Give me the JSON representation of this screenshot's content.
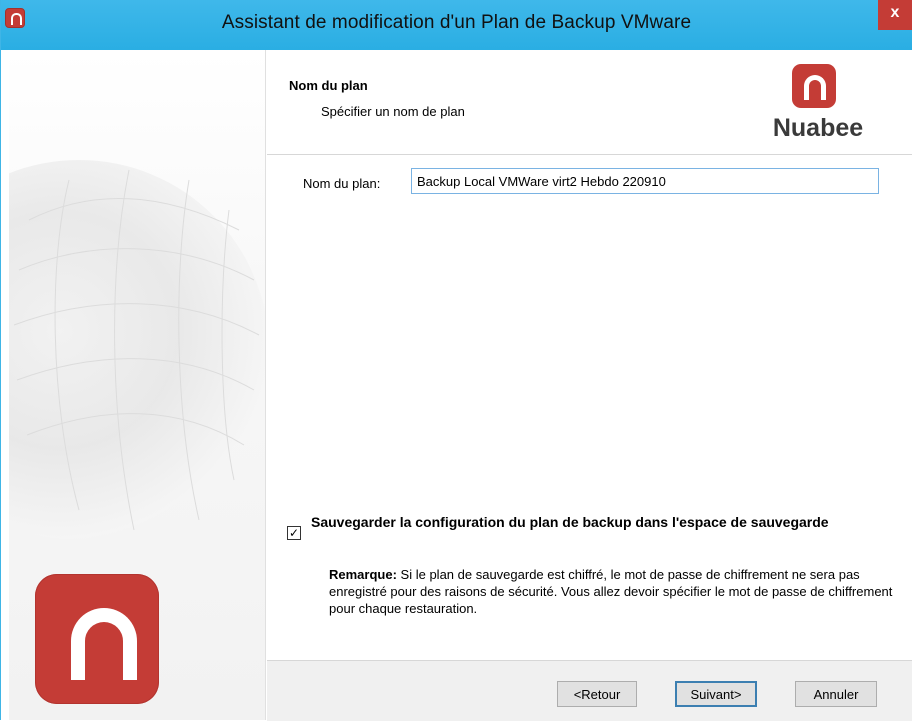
{
  "window": {
    "title": "Assistant de modification d'un Plan de Backup VMware",
    "close_label": "x"
  },
  "header": {
    "title": "Nom du plan",
    "subtitle": "Spécifier un nom de plan",
    "brand_name": "Nuabee"
  },
  "form": {
    "label": "Nom du plan:",
    "value": "Backup Local VMWare virt2 Hebdo 220910"
  },
  "checkbox": {
    "checked": true,
    "label": "Sauvegarder la configuration du plan de backup dans l'espace de sauvegarde"
  },
  "note": {
    "label": "Remarque:",
    "text": "Si le plan de sauvegarde est chiffré, le mot de passe de chiffrement ne sera pas enregistré pour des raisons de sécurité. Vous allez devoir spécifier le mot de passe de chiffrement pour chaque restauration."
  },
  "buttons": {
    "back": "<Retour",
    "next": "Suivant>",
    "cancel": "Annuler"
  },
  "colors": {
    "titlebar": "#2aaee3",
    "brand_red": "#c43c36"
  }
}
